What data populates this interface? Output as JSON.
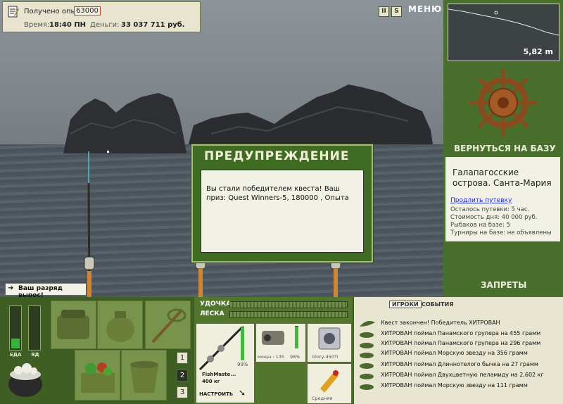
{
  "hud": {
    "exp_label": "Получено опыта",
    "exp_value": "63000",
    "time_label": "Время:",
    "time_value": "18:40 ПН",
    "money_label": "Деньги:",
    "money_value": "33 037 711 руб."
  },
  "top_controls": {
    "pause_label": "II",
    "s_label": "S",
    "menu_label": "МЕНЮ"
  },
  "depth": {
    "value": "5,82 m"
  },
  "right_panel": {
    "return_label": "ВЕРНУТЬСЯ НА БАЗУ",
    "base_name": "Галапагосские острова. Санта-Мария",
    "extend_link": "Продлить путевку",
    "lines": [
      "Осталось путевки: 5 час.",
      "Стоимость дня: 40 000 руб.",
      "Рыбаков на базе: 5",
      "Турниры на базе: не объявлены"
    ],
    "bans_label": "ЗАПРЕТЫ"
  },
  "dialog": {
    "title": "ПРЕДУПРЕЖДЕНИЕ",
    "text": "Вы стали победителем квеста! Ваш приз: Quest Winners-5, 180000 , Опыта"
  },
  "rank_notice": "Ваш разряд вырос!",
  "gauges": {
    "left_label": "ЕДА",
    "right_label": "ЯД",
    "food_level": 0.25,
    "poison_level": 0.0
  },
  "page_buttons": [
    "1",
    "2",
    "3"
  ],
  "active_page": "2",
  "tackle": {
    "rod_label": "УДОЧКА",
    "line_label": "ЛЕСКА",
    "rod_name": "FishMaste...",
    "rod_weight": "400 кг",
    "rod_percent": "99%",
    "reel_label": "мощн.: 135",
    "reel_percent": "98%",
    "line_name": "Glory-450Ti",
    "lure_label": "Средняя",
    "setup_label": "НАСТРОИТЬ"
  },
  "events": {
    "tab_players": "ИГРОКИ",
    "tab_events": "СОБЫТИЯ",
    "rows": [
      "Квест закончен! Победитель ХИТРОВАН",
      "ХИТРОВАН поймал Панамского групера на 455 грамм",
      "ХИТРОВАН поймал Панамского групера на 296 грамм",
      "ХИТРОВАН поймал Морскую звезду на 356 грамм",
      "ХИТРОВАН поймал Длиннотелого бычка на 27 грамм",
      "ХИТРОВАН поймал Двухцветную пеламиду на 2,602 кг",
      "ХИТРОВАН поймал Морскую звезду на 111 грамм"
    ]
  },
  "colors": {
    "panel_green": "#496f2c",
    "dark_green": "#3e5e24",
    "cream": "#f2f1e6",
    "highlight_red": "#d03a2a"
  }
}
